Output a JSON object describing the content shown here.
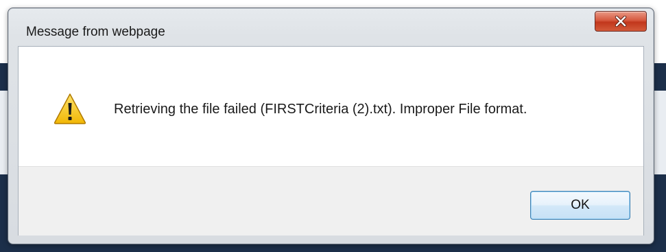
{
  "dialog": {
    "title": "Message from webpage",
    "close_icon": "close-icon",
    "message": "Retrieving the file failed (FIRSTCriteria (2).txt). Improper File format.",
    "icon": "warning-icon",
    "ok_label": "OK"
  },
  "colors": {
    "close_button": "#c1371c",
    "ok_button_border": "#3c7fb1",
    "footer_background": "#f0f0f0",
    "warning_fill": "#f5c21b"
  }
}
